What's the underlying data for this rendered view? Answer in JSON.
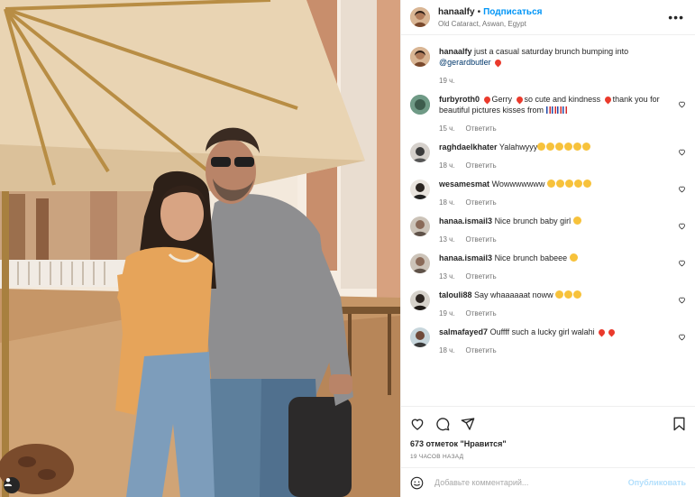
{
  "post": {
    "username": "hanaalfy",
    "follow_label": "Подписаться",
    "location": "Old Cataract, Aswan, Egypt",
    "more_label": "•••",
    "separator": "•"
  },
  "caption": {
    "username": "hanaalfy",
    "text": " just a casual saturday brunch bumping into ",
    "mention": "@gerardbutler",
    "time": "19 ч."
  },
  "comments": [
    {
      "username": "furbyroth0",
      "text": "Gerry",
      "text2": "so cute and kindness",
      "text3": "thank you for beautiful pictures kisses from",
      "time": "15 ч.",
      "reply": "Ответить"
    },
    {
      "username": "raghdaelkhater",
      "text": "Yalahwyyy",
      "time": "18 ч.",
      "reply": "Ответить"
    },
    {
      "username": "wesamesmat",
      "text": "Wowwwwwww",
      "time": "18 ч.",
      "reply": "Ответить"
    },
    {
      "username": "hanaa.ismail3",
      "text": "Nice brunch baby girl",
      "time": "13 ч.",
      "reply": "Ответить"
    },
    {
      "username": "hanaa.ismail3",
      "text": "Nice brunch babeee",
      "time": "13 ч.",
      "reply": "Ответить"
    },
    {
      "username": "talouli88",
      "text": "Say whaaaaaat noww",
      "time": "19 ч.",
      "reply": "Ответить"
    },
    {
      "username": "salmafayed7",
      "text": "Ouffff such a lucky girl walahi",
      "time": "18 ч.",
      "reply": "Ответить"
    }
  ],
  "actions": {
    "likes": "673 отметок \"Нравится\"",
    "time": "19 часов назад",
    "comment_placeholder": "Добавьте комментарий...",
    "post_label": "Опубликовать"
  },
  "icons": {
    "like": "heart-icon",
    "comment": "comment-icon",
    "share": "share-icon",
    "save": "bookmark-icon",
    "emoji": "smiley-icon",
    "more": "more-icon",
    "profile": "profile-icon"
  },
  "colors": {
    "accent": "#0095f6",
    "mention": "#00376b",
    "heart": "#ea3a2c",
    "muted": "#737373"
  }
}
